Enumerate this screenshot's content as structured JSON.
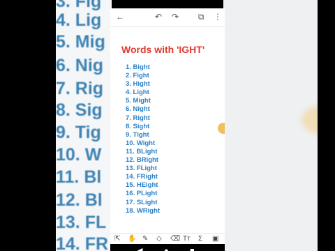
{
  "background": {
    "lines": [
      "3. Fig",
      "4. Lig",
      "5. Mig",
      "6. Nig",
      "7. Rig",
      "8. Sig",
      "9. Tig",
      "10. W",
      "11. Bl",
      "12. Bl",
      "13. FL",
      "14. FR"
    ]
  },
  "toolbar": {
    "back_icon": "←",
    "undo_icon": "↶",
    "redo_icon": "↷",
    "pages_icon": "⧉",
    "more_icon": "⋮"
  },
  "page": {
    "title": "Words with 'IGHT'",
    "words": [
      "1. Bight",
      "2. Fight",
      "3. Hight",
      "4. Light",
      "5. Might",
      "6. Night",
      "7. Right",
      "8. Sight",
      "9. Tight",
      "10. Wight",
      "11. BLight",
      "12. BRight",
      "13. FLight",
      "14. FRight",
      "15. HEight",
      "16. PLight",
      "17. SLight",
      "18. WRight"
    ]
  },
  "bottom_tools": {
    "select": "⇱",
    "hand": "✋",
    "pen": "✎",
    "shapes": "◇",
    "eraser": "⌫",
    "text": "Tт",
    "formula": "Σ",
    "image": "▣"
  },
  "navbar": {
    "back": "◀",
    "home": "●",
    "recent": "■"
  },
  "colors": {
    "title": "#e0392f",
    "words": "#2a7fc8"
  }
}
